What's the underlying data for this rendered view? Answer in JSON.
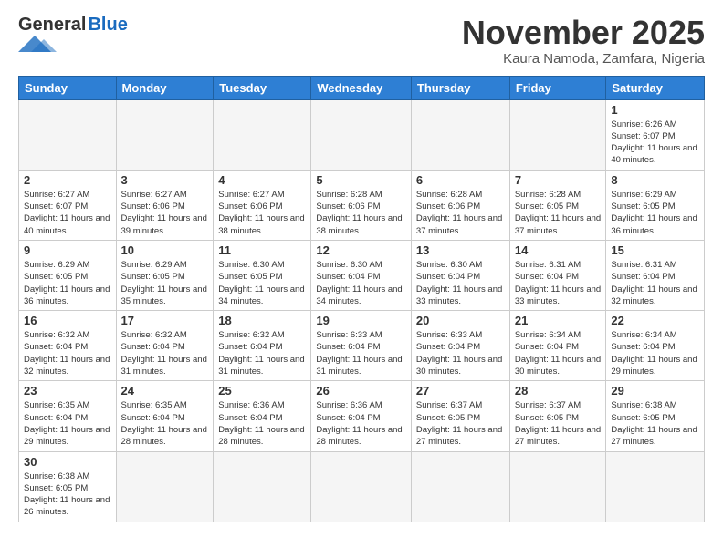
{
  "header": {
    "logo_general": "General",
    "logo_blue": "Blue",
    "month_title": "November 2025",
    "location": "Kaura Namoda, Zamfara, Nigeria"
  },
  "days_of_week": [
    "Sunday",
    "Monday",
    "Tuesday",
    "Wednesday",
    "Thursday",
    "Friday",
    "Saturday"
  ],
  "weeks": [
    [
      {
        "day": "",
        "info": ""
      },
      {
        "day": "",
        "info": ""
      },
      {
        "day": "",
        "info": ""
      },
      {
        "day": "",
        "info": ""
      },
      {
        "day": "",
        "info": ""
      },
      {
        "day": "",
        "info": ""
      },
      {
        "day": "1",
        "info": "Sunrise: 6:26 AM\nSunset: 6:07 PM\nDaylight: 11 hours and 40 minutes."
      }
    ],
    [
      {
        "day": "2",
        "info": "Sunrise: 6:27 AM\nSunset: 6:07 PM\nDaylight: 11 hours and 40 minutes."
      },
      {
        "day": "3",
        "info": "Sunrise: 6:27 AM\nSunset: 6:06 PM\nDaylight: 11 hours and 39 minutes."
      },
      {
        "day": "4",
        "info": "Sunrise: 6:27 AM\nSunset: 6:06 PM\nDaylight: 11 hours and 38 minutes."
      },
      {
        "day": "5",
        "info": "Sunrise: 6:28 AM\nSunset: 6:06 PM\nDaylight: 11 hours and 38 minutes."
      },
      {
        "day": "6",
        "info": "Sunrise: 6:28 AM\nSunset: 6:06 PM\nDaylight: 11 hours and 37 minutes."
      },
      {
        "day": "7",
        "info": "Sunrise: 6:28 AM\nSunset: 6:05 PM\nDaylight: 11 hours and 37 minutes."
      },
      {
        "day": "8",
        "info": "Sunrise: 6:29 AM\nSunset: 6:05 PM\nDaylight: 11 hours and 36 minutes."
      }
    ],
    [
      {
        "day": "9",
        "info": "Sunrise: 6:29 AM\nSunset: 6:05 PM\nDaylight: 11 hours and 36 minutes."
      },
      {
        "day": "10",
        "info": "Sunrise: 6:29 AM\nSunset: 6:05 PM\nDaylight: 11 hours and 35 minutes."
      },
      {
        "day": "11",
        "info": "Sunrise: 6:30 AM\nSunset: 6:05 PM\nDaylight: 11 hours and 34 minutes."
      },
      {
        "day": "12",
        "info": "Sunrise: 6:30 AM\nSunset: 6:04 PM\nDaylight: 11 hours and 34 minutes."
      },
      {
        "day": "13",
        "info": "Sunrise: 6:30 AM\nSunset: 6:04 PM\nDaylight: 11 hours and 33 minutes."
      },
      {
        "day": "14",
        "info": "Sunrise: 6:31 AM\nSunset: 6:04 PM\nDaylight: 11 hours and 33 minutes."
      },
      {
        "day": "15",
        "info": "Sunrise: 6:31 AM\nSunset: 6:04 PM\nDaylight: 11 hours and 32 minutes."
      }
    ],
    [
      {
        "day": "16",
        "info": "Sunrise: 6:32 AM\nSunset: 6:04 PM\nDaylight: 11 hours and 32 minutes."
      },
      {
        "day": "17",
        "info": "Sunrise: 6:32 AM\nSunset: 6:04 PM\nDaylight: 11 hours and 31 minutes."
      },
      {
        "day": "18",
        "info": "Sunrise: 6:32 AM\nSunset: 6:04 PM\nDaylight: 11 hours and 31 minutes."
      },
      {
        "day": "19",
        "info": "Sunrise: 6:33 AM\nSunset: 6:04 PM\nDaylight: 11 hours and 31 minutes."
      },
      {
        "day": "20",
        "info": "Sunrise: 6:33 AM\nSunset: 6:04 PM\nDaylight: 11 hours and 30 minutes."
      },
      {
        "day": "21",
        "info": "Sunrise: 6:34 AM\nSunset: 6:04 PM\nDaylight: 11 hours and 30 minutes."
      },
      {
        "day": "22",
        "info": "Sunrise: 6:34 AM\nSunset: 6:04 PM\nDaylight: 11 hours and 29 minutes."
      }
    ],
    [
      {
        "day": "23",
        "info": "Sunrise: 6:35 AM\nSunset: 6:04 PM\nDaylight: 11 hours and 29 minutes."
      },
      {
        "day": "24",
        "info": "Sunrise: 6:35 AM\nSunset: 6:04 PM\nDaylight: 11 hours and 28 minutes."
      },
      {
        "day": "25",
        "info": "Sunrise: 6:36 AM\nSunset: 6:04 PM\nDaylight: 11 hours and 28 minutes."
      },
      {
        "day": "26",
        "info": "Sunrise: 6:36 AM\nSunset: 6:04 PM\nDaylight: 11 hours and 28 minutes."
      },
      {
        "day": "27",
        "info": "Sunrise: 6:37 AM\nSunset: 6:05 PM\nDaylight: 11 hours and 27 minutes."
      },
      {
        "day": "28",
        "info": "Sunrise: 6:37 AM\nSunset: 6:05 PM\nDaylight: 11 hours and 27 minutes."
      },
      {
        "day": "29",
        "info": "Sunrise: 6:38 AM\nSunset: 6:05 PM\nDaylight: 11 hours and 27 minutes."
      }
    ],
    [
      {
        "day": "30",
        "info": "Sunrise: 6:38 AM\nSunset: 6:05 PM\nDaylight: 11 hours and 26 minutes."
      },
      {
        "day": "",
        "info": ""
      },
      {
        "day": "",
        "info": ""
      },
      {
        "day": "",
        "info": ""
      },
      {
        "day": "",
        "info": ""
      },
      {
        "day": "",
        "info": ""
      },
      {
        "day": "",
        "info": ""
      }
    ]
  ]
}
